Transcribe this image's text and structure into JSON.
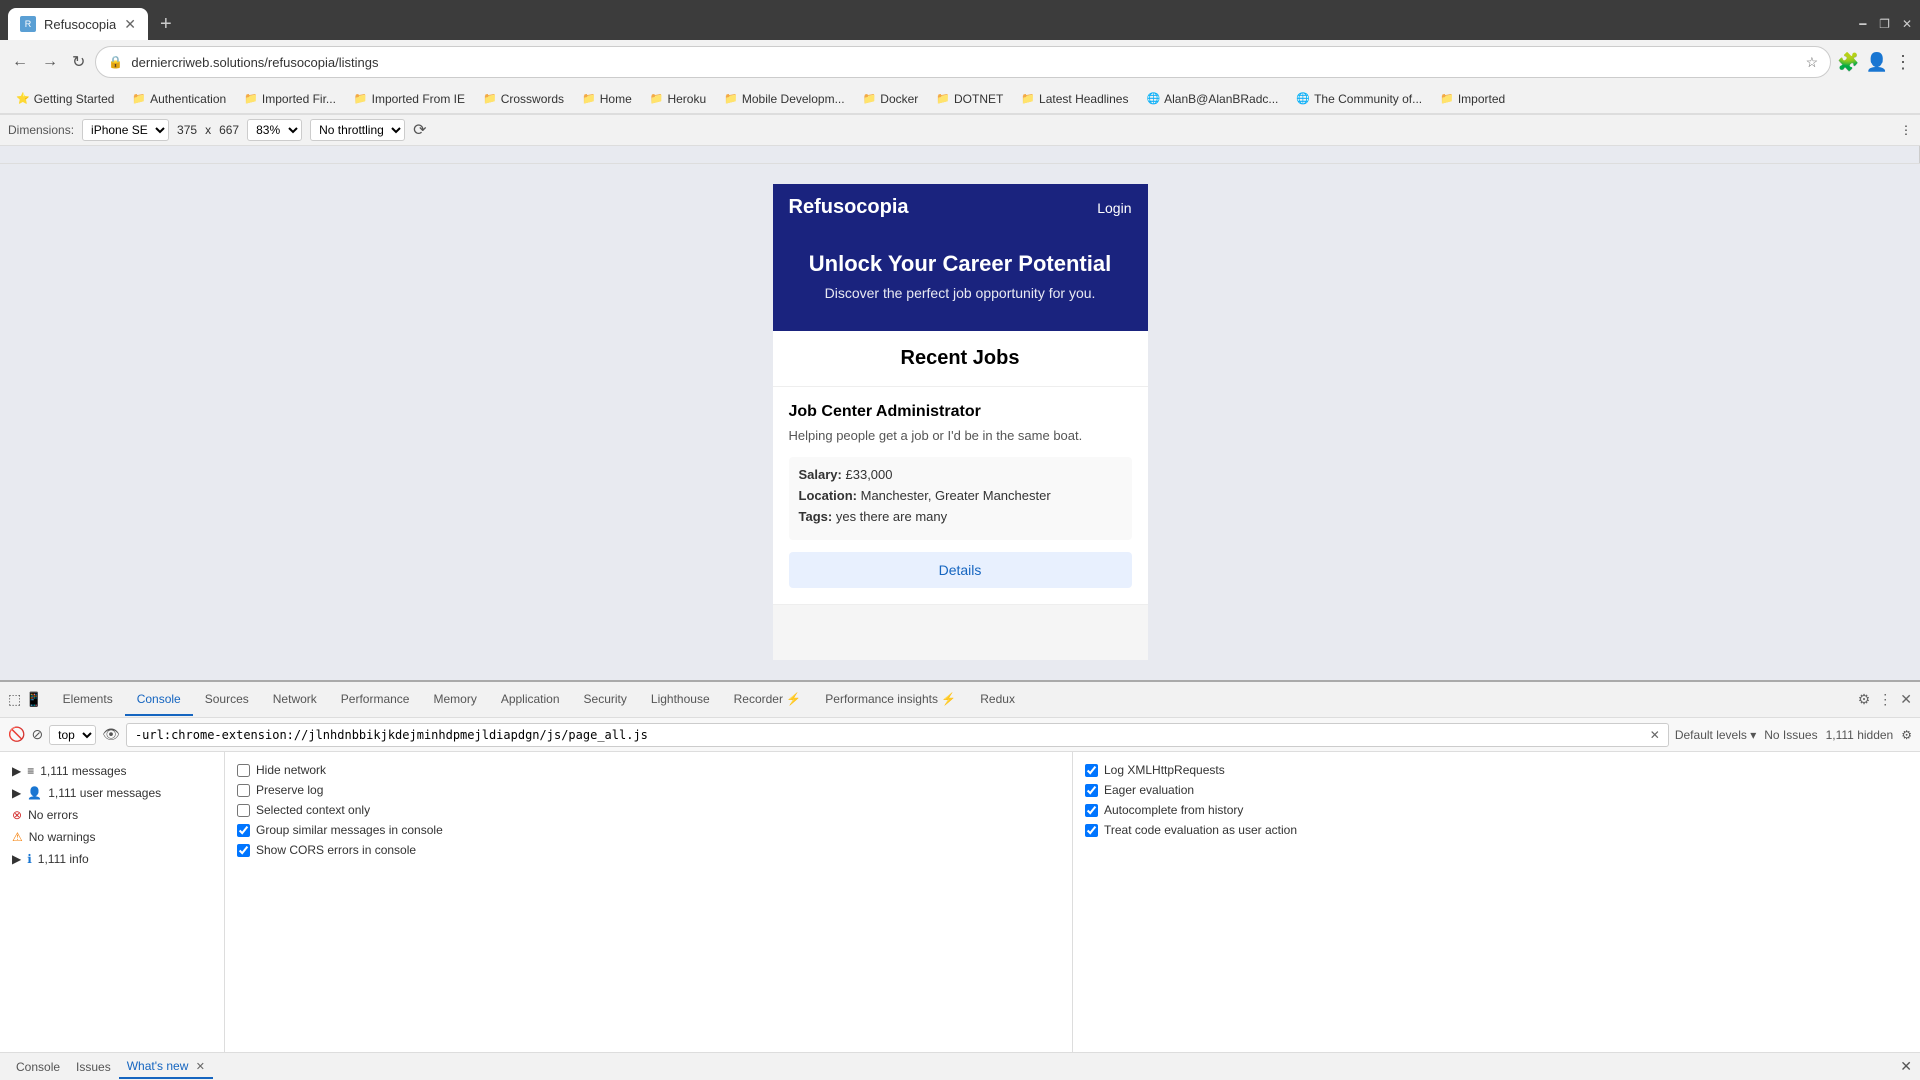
{
  "browser": {
    "tab": {
      "favicon_text": "R",
      "title": "Refusocopia"
    },
    "new_tab_label": "+",
    "address": "derniercriweb.solutions/refusocopia/listings",
    "nav_back_disabled": false,
    "nav_forward_disabled": false
  },
  "bookmarks": [
    {
      "label": "Getting Started",
      "icon": "⭐"
    },
    {
      "label": "Authentication",
      "icon": "📁"
    },
    {
      "label": "Imported Fir...",
      "icon": "📁"
    },
    {
      "label": "Imported From IE",
      "icon": "📁"
    },
    {
      "label": "Crosswords",
      "icon": "📁"
    },
    {
      "label": "Home",
      "icon": "📁"
    },
    {
      "label": "Heroku",
      "icon": "📁"
    },
    {
      "label": "Mobile Developm...",
      "icon": "📁"
    },
    {
      "label": "Docker",
      "icon": "📁"
    },
    {
      "label": "DOTNET",
      "icon": "📁"
    },
    {
      "label": "Latest Headlines",
      "icon": "📁"
    },
    {
      "label": "AlanB@AlanBRadc...",
      "icon": "🌐"
    },
    {
      "label": "The Community of...",
      "icon": "🌐"
    },
    {
      "label": "Imported",
      "icon": "📁"
    }
  ],
  "viewport_bar": {
    "device": "iPhone SE",
    "width": "375",
    "x_label": "x",
    "height": "667",
    "zoom": "83%",
    "throttling": "No throttling"
  },
  "app": {
    "logo": "Refusocopia",
    "login_label": "Login",
    "hero_title": "Unlock Your Career Potential",
    "hero_subtitle": "Discover the perfect job opportunity for you.",
    "jobs_section_title": "Recent Jobs",
    "job": {
      "title": "Job Center Administrator",
      "description": "Helping people get a job or I'd be in the same boat.",
      "salary_label": "Salary:",
      "salary": "£33,000",
      "location_label": "Location:",
      "location": "Manchester, Greater Manchester",
      "tags_label": "Tags:",
      "tags": "yes there are many",
      "details_btn": "Details"
    }
  },
  "devtools": {
    "tabs": [
      {
        "label": "Elements",
        "active": false
      },
      {
        "label": "Console",
        "active": true
      },
      {
        "label": "Sources",
        "active": false
      },
      {
        "label": "Network",
        "active": false
      },
      {
        "label": "Performance",
        "active": false
      },
      {
        "label": "Memory",
        "active": false
      },
      {
        "label": "Application",
        "active": false
      },
      {
        "label": "Security",
        "active": false
      },
      {
        "label": "Lighthouse",
        "active": false
      },
      {
        "label": "Recorder ⚡",
        "active": false
      },
      {
        "label": "Performance insights ⚡",
        "active": false
      },
      {
        "label": "Redux",
        "active": false
      }
    ],
    "console_bar": {
      "context": "top",
      "input_value": "-url:chrome-extension://jlnhdnbbikjkdejminhdpmejldiapdgn/js/page_all.js",
      "clear_btn": "🚫",
      "default_levels": "Default levels",
      "no_issues": "No Issues",
      "hidden_count": "1,111 hidden"
    },
    "left_panel": [
      {
        "label": "1,111 messages",
        "icon": "list",
        "count": ""
      },
      {
        "label": "1,111 user messages",
        "icon": "user",
        "count": ""
      },
      {
        "label": "No errors",
        "icon": "error",
        "count": ""
      },
      {
        "label": "No warnings",
        "icon": "warning",
        "count": ""
      },
      {
        "label": "1,111 info",
        "icon": "info",
        "count": ""
      }
    ],
    "middle_checkboxes": [
      {
        "label": "Hide network",
        "checked": false
      },
      {
        "label": "Preserve log",
        "checked": false
      },
      {
        "label": "Selected context only",
        "checked": false
      },
      {
        "label": "Group similar messages in console",
        "checked": true
      },
      {
        "label": "Show CORS errors in console",
        "checked": true
      }
    ],
    "right_checkboxes": [
      {
        "label": "Log XMLHttpRequests",
        "checked": true
      },
      {
        "label": "Eager evaluation",
        "checked": true
      },
      {
        "label": "Autocomplete from history",
        "checked": true
      },
      {
        "label": "Treat code evaluation as user action",
        "checked": true
      }
    ],
    "bottom_tabs": [
      {
        "label": "Console",
        "active": false
      },
      {
        "label": "Issues",
        "active": false
      },
      {
        "label": "What's new",
        "active": true,
        "closeable": true
      }
    ]
  }
}
